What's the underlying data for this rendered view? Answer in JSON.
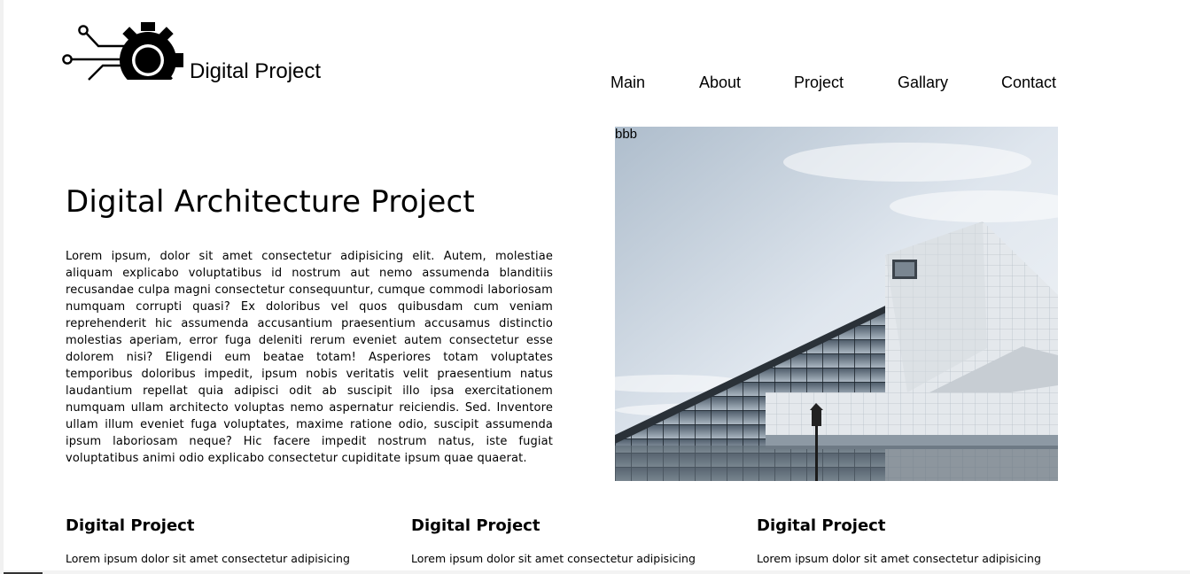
{
  "header": {
    "brand": "Digital Project",
    "logo_icon": "gear-circuit-icon"
  },
  "nav": {
    "items": [
      {
        "label": "Main"
      },
      {
        "label": "About"
      },
      {
        "label": "Project"
      },
      {
        "label": "Gallary"
      },
      {
        "label": "Contact"
      }
    ]
  },
  "hero": {
    "title": "Digital Architecture Project",
    "text": "Lorem ipsum, dolor sit amet consectetur adipisicing elit. Autem, molestiae aliquam explicabo voluptatibus id nostrum aut nemo assumenda blanditiis recusandae culpa magni consectetur consequuntur, cumque commodi laboriosam numquam corrupti quasi? Ex doloribus vel quos quibusdam cum veniam reprehenderit hic assumenda accusantium praesentium accusamus distinctio molestias aperiam, error fuga deleniti rerum eveniet autem consectetur esse dolorem nisi? Eligendi eum beatae totam! Asperiores totam voluptates temporibus doloribus impedit, ipsum nobis veritatis velit praesentium natus laudantium repellat quia adipisci odit ab suscipit illo ipsa exercitationem numquam ullam architecto voluptas nemo aspernatur reiciendis. Sed. Inventore ullam illum eveniet fuga voluptates, maxime ratione odio, suscipit assumenda ipsum laboriosam neque? Hic facere impedit nostrum natus, iste fugiat voluptatibus animi odio explicabo consectetur cupiditate ipsum quae quaerat.",
    "image_alt": "bbb"
  },
  "features": [
    {
      "title": "Digital Project",
      "text": "Lorem ipsum dolor sit amet consectetur adipisicing"
    },
    {
      "title": "Digital Project",
      "text": "Lorem ipsum dolor sit amet consectetur adipisicing"
    },
    {
      "title": "Digital Project",
      "text": "Lorem ipsum dolor sit amet consectetur adipisicing"
    }
  ]
}
